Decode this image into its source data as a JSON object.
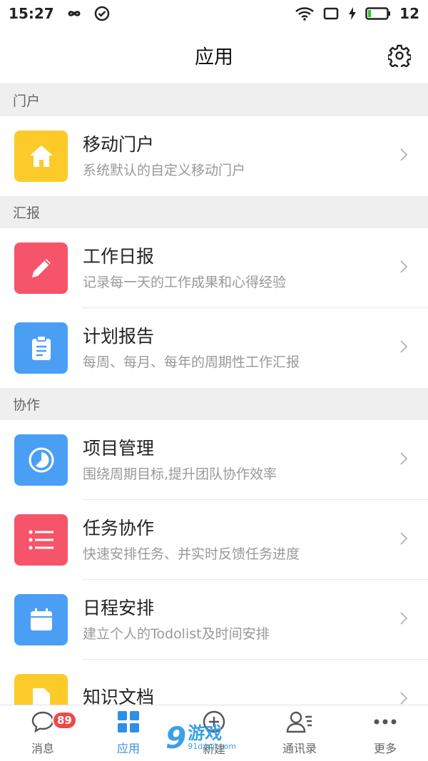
{
  "status_bar": {
    "time": "15:27",
    "battery": "12"
  },
  "header": {
    "title": "应用"
  },
  "sections": [
    {
      "title": "门户",
      "items": [
        {
          "name": "移动门户",
          "desc": "系统默认的自定义移动门户",
          "icon": "home-icon",
          "color": "#fccb2a"
        }
      ]
    },
    {
      "title": "汇报",
      "items": [
        {
          "name": "工作日报",
          "desc": "记录每一天的工作成果和心得经验",
          "icon": "pencil-icon",
          "color": "#f6546a"
        },
        {
          "name": "计划报告",
          "desc": "每周、每月、每年的周期性工作汇报",
          "icon": "clipboard-icon",
          "color": "#4a9ff5"
        }
      ]
    },
    {
      "title": "协作",
      "items": [
        {
          "name": "项目管理",
          "desc": "围绕周期目标,提升团队协作效率",
          "icon": "clock-icon",
          "color": "#4a9ff5"
        },
        {
          "name": "任务协作",
          "desc": "快速安排任务、并实时反馈任务进度",
          "icon": "list-icon",
          "color": "#f6546a"
        },
        {
          "name": "日程安排",
          "desc": "建立个人的Todolist及时间安排",
          "icon": "calendar-icon",
          "color": "#4a9ff5"
        },
        {
          "name": "知识文档",
          "desc": "",
          "icon": "document-icon",
          "color": "#fccb2a"
        }
      ]
    }
  ],
  "tabbar": {
    "tabs": [
      {
        "label": "消息",
        "icon": "chat-icon",
        "badge": "89"
      },
      {
        "label": "应用",
        "icon": "apps-grid-icon"
      },
      {
        "label": "新建",
        "icon": "add-icon"
      },
      {
        "label": "通讯录",
        "icon": "contacts-icon"
      },
      {
        "label": "更多",
        "icon": "more-icon"
      }
    ]
  },
  "watermark": {
    "number": "9",
    "text": "游戏",
    "url": "91danji.com"
  },
  "colors": {
    "accent": "#2e8fe8",
    "yellow": "#fccb2a",
    "red": "#f6546a",
    "blue": "#4a9ff5"
  }
}
